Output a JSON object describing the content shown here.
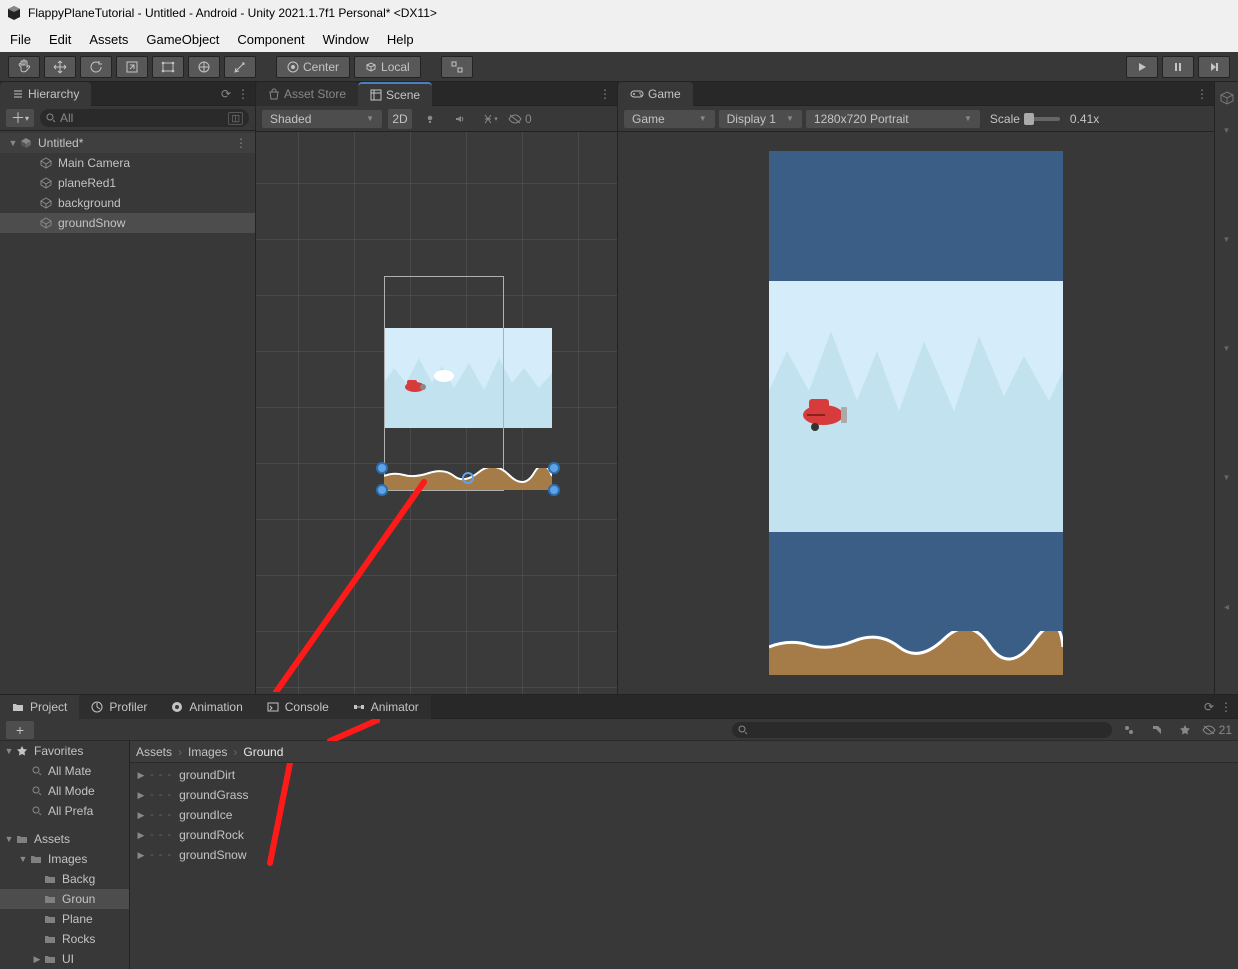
{
  "window": {
    "title": "FlappyPlaneTutorial - Untitled - Android - Unity 2021.1.7f1 Personal* <DX11>"
  },
  "menu": [
    "File",
    "Edit",
    "Assets",
    "GameObject",
    "Component",
    "Window",
    "Help"
  ],
  "toolbar": {
    "pivot": "Center",
    "handle": "Local"
  },
  "hierarchy": {
    "title": "Hierarchy",
    "search": "All",
    "scene": "Untitled*",
    "items": [
      "Main Camera",
      "planeRed1",
      "background",
      "groundSnow"
    ]
  },
  "scene": {
    "tabs": {
      "asset_store": "Asset Store",
      "scene": "Scene"
    },
    "shading": "Shaded",
    "mode2d": "2D",
    "gizmo_count": "0"
  },
  "game": {
    "tab": "Game",
    "camera": "Game",
    "display": "Display 1",
    "resolution": "1280x720 Portrait",
    "scale_label": "Scale",
    "scale_value": "0.41x"
  },
  "project": {
    "tabs": {
      "project": "Project",
      "profiler": "Profiler",
      "animation": "Animation",
      "console": "Console",
      "animator": "Animator"
    },
    "add": "+",
    "hidden": "21",
    "breadcrumb": [
      "Assets",
      "Images",
      "Ground"
    ],
    "favorites": {
      "title": "Favorites",
      "items": [
        "All Mate",
        "All Mode",
        "All Prefa"
      ]
    },
    "assets_root": "Assets",
    "folders_parent": "Images",
    "folders": [
      "Backg",
      "Groun",
      "Plane",
      "Rocks",
      "UI"
    ],
    "assets": [
      "groundDirt",
      "groundGrass",
      "groundIce",
      "groundRock",
      "groundSnow"
    ]
  }
}
